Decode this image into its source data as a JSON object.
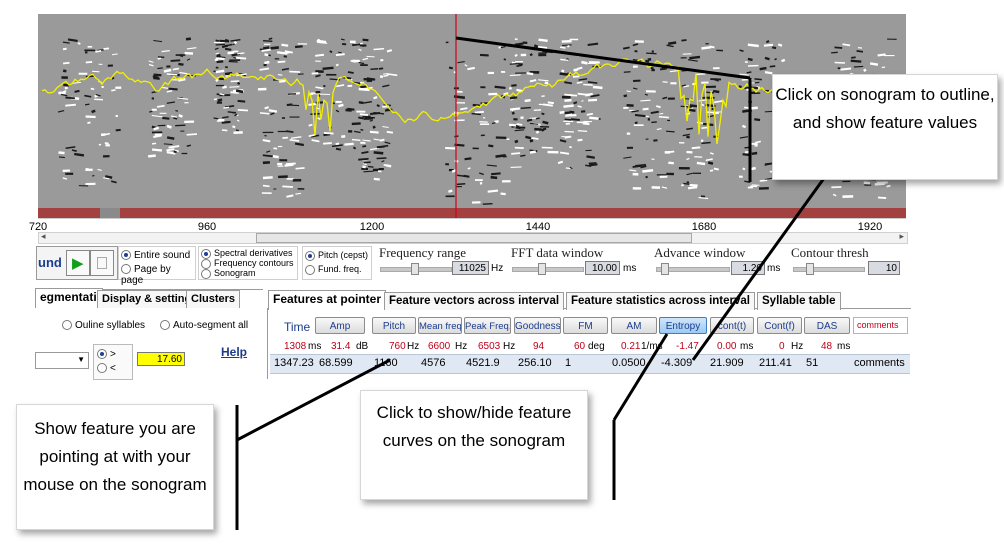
{
  "axis_ticks": [
    "720",
    "960",
    "1200",
    "1440",
    "1680",
    "1920"
  ],
  "sound_button": {
    "label": "und"
  },
  "playback": {
    "play_icon": "play-icon",
    "stop_icon": "stop-icon"
  },
  "view_mode": {
    "options": [
      "Entire sound",
      "Page by page"
    ],
    "selected": "Entire sound"
  },
  "display_mode": {
    "options": [
      "Spectral derivatives",
      "Frequency contours",
      "Sonogram"
    ],
    "selected": "Spectral derivatives"
  },
  "pitch_mode": {
    "options": [
      "Pitch (cepst)",
      "Fund. freq."
    ],
    "selected": "Pitch (cepst)"
  },
  "frequency_range": {
    "label": "Frequency range",
    "value": "11025",
    "unit": "Hz"
  },
  "fft_window": {
    "label": "FFT data window",
    "value": "10.00",
    "unit": "ms"
  },
  "advance_window": {
    "label": "Advance window",
    "value": "1.20",
    "unit": "ms"
  },
  "contour_thresh": {
    "label": "Contour thresh",
    "value": "10"
  },
  "left_tabs": [
    "egmentation",
    "Display & settings",
    "Clusters"
  ],
  "left_panel": {
    "outline_syllables": "Ouline syllables",
    "auto_segment": "Auto-segment all",
    "value": "17.60",
    "help": "Help",
    "direction_options": [
      ">",
      "<"
    ]
  },
  "feature_tabs": [
    "Features at pointer",
    "Feature vectors across interval",
    "Feature statistics across interval",
    "Syllable table"
  ],
  "feature_header": {
    "time_label": "Time",
    "buttons": [
      "Amp",
      "Pitch",
      "Mean freq.",
      "Peak Freq.",
      "Goodness",
      "FM",
      "AM",
      "Entropy",
      "cont(t)",
      "Cont(f)",
      "DAS"
    ],
    "selected": "Entropy",
    "comments_label": "comments"
  },
  "feature_readout": [
    {
      "value": "1308",
      "unit": "ms"
    },
    {
      "value": "31.4",
      "unit": "dB"
    },
    {
      "value": "760",
      "unit": "Hz"
    },
    {
      "value": "6600",
      "unit": "Hz"
    },
    {
      "value": "6503",
      "unit": "Hz"
    },
    {
      "value": "94",
      "unit": ""
    },
    {
      "value": "60",
      "unit": "deg"
    },
    {
      "value": "0.21",
      "unit": "1/ms"
    },
    {
      "value": "-1.47",
      "unit": ""
    },
    {
      "value": "0.00",
      "unit": "ms"
    },
    {
      "value": "0",
      "unit": "Hz"
    },
    {
      "value": "48",
      "unit": "ms"
    }
  ],
  "feature_values": [
    "1347.23",
    "68.599",
    "1160",
    "4576",
    "4521.9",
    "256.10",
    "1",
    "0.0500",
    "-4.309",
    "21.909",
    "211.41",
    "51",
    "comments"
  ],
  "callouts": {
    "sonogram": "Click on sonogram to outline, and show feature values",
    "pointer": "Show feature you are pointing at with your mouse on the sonogram",
    "toggle": "Click to show/hide feature curves on the sonogram"
  },
  "colors": {
    "pitch_curve": "#f2ef00",
    "cursor": "#d0021b",
    "bottom_band": "#a34040",
    "selected_button": "#9ccaf2",
    "readout_red": "#c0001a"
  }
}
